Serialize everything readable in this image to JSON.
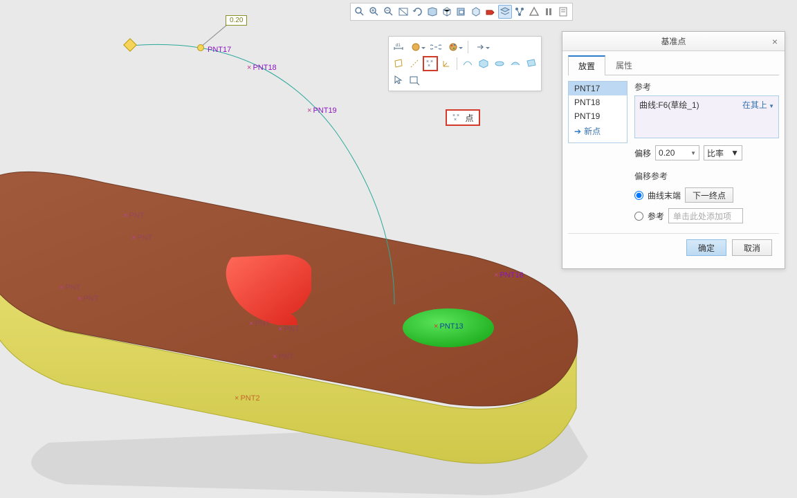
{
  "canvas": {
    "dim_value": "0.20",
    "points": {
      "pnt17": "PNT17",
      "pnt18": "PNT18",
      "pnt19": "PNT19",
      "pnt13": "PNT13",
      "pnt16": "PNT16",
      "pnt2": "PNT2"
    }
  },
  "top_toolbar": {
    "icons": [
      "zoom-fit-icon",
      "zoom-in-icon",
      "zoom-out-icon",
      "zoom-window-icon",
      "rotate-icon",
      "pan-icon",
      "standard-view-icon",
      "saved-view-icon",
      "display-style-icon",
      "annotation-icon",
      "layers-icon",
      "plane-icon",
      "triangle-icon",
      "pause-icon",
      "info-icon"
    ]
  },
  "context_toolbar": {
    "row1": [
      {
        "name": "dimension-icon"
      },
      {
        "name": "appearance-icon",
        "dd": true
      },
      {
        "name": "chain-icon"
      },
      {
        "name": "paint-icon",
        "dd": true
      },
      {
        "name": "arrow-flyout-icon",
        "dd": true
      }
    ],
    "row2": [
      {
        "name": "plane-icon"
      },
      {
        "name": "axis-icon"
      },
      {
        "name": "point-icon",
        "hl": true
      },
      {
        "name": "csys-icon"
      },
      {
        "name": "spacer-sep"
      },
      {
        "name": "surface-icon"
      },
      {
        "name": "quilt-icon"
      },
      {
        "name": "merge-icon"
      },
      {
        "name": "extend-icon"
      },
      {
        "name": "trim-icon"
      }
    ],
    "row3": [
      {
        "name": "select-icon"
      },
      {
        "name": "query-icon"
      }
    ]
  },
  "tooltip": {
    "label": "点"
  },
  "dialog": {
    "title": "基准点",
    "tabs": {
      "place": "放置",
      "props": "属性"
    },
    "points_header": "",
    "point_list": [
      "PNT17",
      "PNT18",
      "PNT19"
    ],
    "new_point": "新点",
    "ref_label": "参考",
    "ref_text": "曲线:F6(草绘_1)",
    "ref_constraint": "在其上",
    "offset_label": "偏移",
    "offset_value": "0.20",
    "offset_mode": "比率",
    "offset_ref_header": "偏移参考",
    "radio_curve_end": "曲线末端",
    "btn_next_end": "下一终点",
    "radio_ref": "参考",
    "ref_placeholder": "单击此处添加项",
    "ok": "确定",
    "cancel": "取消"
  }
}
